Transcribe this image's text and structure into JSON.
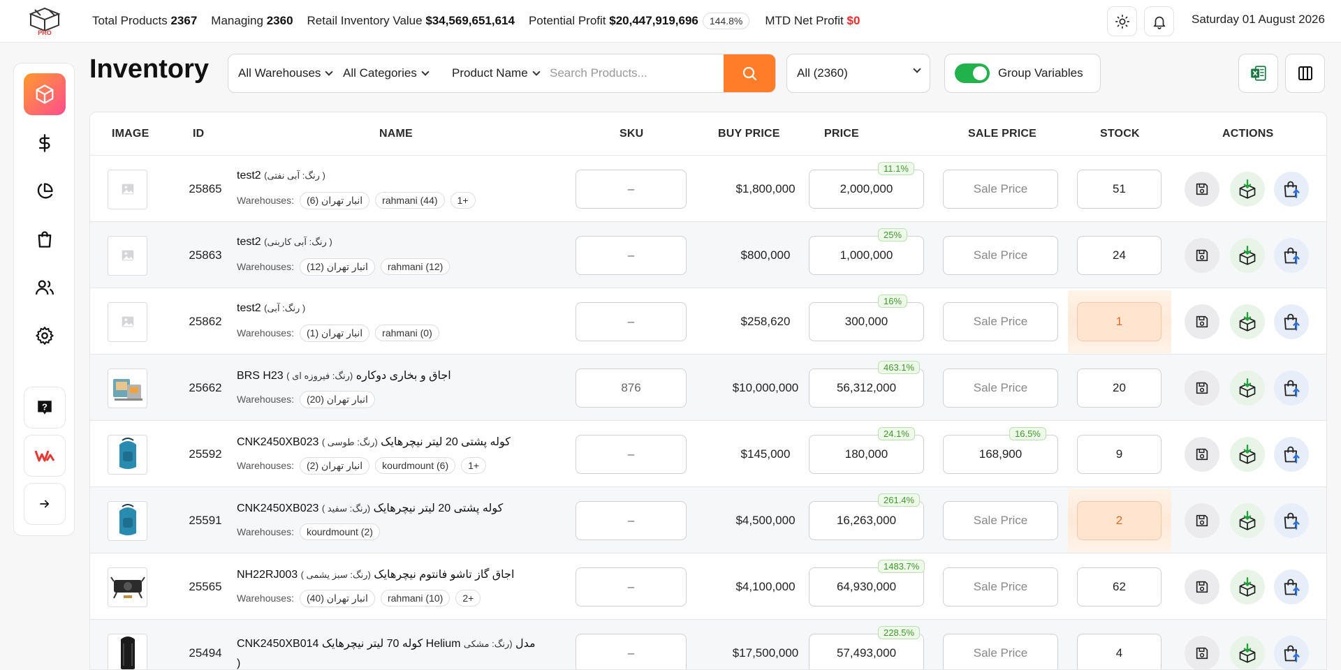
{
  "header": {
    "logo_text": "PRO",
    "total_products_label": "Total Products",
    "total_products": "2367",
    "managing_label": "Managing",
    "managing": "2360",
    "retail_value_label": "Retail Inventory Value",
    "retail_value": "$34,569,651,614",
    "potential_profit_label": "Potential Profit",
    "potential_profit": "$20,447,919,696",
    "potential_profit_pct": "144.8%",
    "mtd_label": "MTD Net Profit",
    "mtd_value": "$0",
    "date": "Saturday 01 August 2026"
  },
  "page": {
    "title": "Inventory"
  },
  "filters": {
    "warehouses": "All Warehouses",
    "categories": "All Categories",
    "field": "Product Name",
    "search_placeholder": "Search Products...",
    "all_select": "All (2360)",
    "group_label": "Group Variables",
    "group_on": true
  },
  "table": {
    "headers": [
      "IMAGE",
      "ID",
      "NAME",
      "SKU",
      "BUY PRICE",
      "PRICE",
      "SALE PRICE",
      "STOCK",
      "ACTIONS"
    ],
    "warehouses_label": "Warehouses:",
    "sale_placeholder": "Sale Price",
    "rows": [
      {
        "id": "25865",
        "name": "test2",
        "variant": "(رنگ: آبی نفتی )",
        "chips": [
          "انبار تهران (6)",
          "rahmani (44)",
          "1+"
        ],
        "sku": "–",
        "buy": "$1,800,000",
        "price": "2,000,000",
        "price_pct": "11.1%",
        "sale": "",
        "sale_pct": "",
        "stock": "51",
        "low": false,
        "img": "placeholder"
      },
      {
        "id": "25863",
        "name": "test2",
        "variant": "(رنگ: آبی کاربنی )",
        "chips": [
          "انبار تهران (12)",
          "rahmani (12)"
        ],
        "sku": "–",
        "buy": "$800,000",
        "price": "1,000,000",
        "price_pct": "25%",
        "sale": "",
        "sale_pct": "",
        "stock": "24",
        "low": false,
        "img": "placeholder"
      },
      {
        "id": "25862",
        "name": "test2",
        "variant": "(رنگ: آبی )",
        "chips": [
          "انبار تهران (1)",
          "rahmani (0)"
        ],
        "sku": "–",
        "buy": "$258,620",
        "price": "300,000",
        "price_pct": "16%",
        "sale": "",
        "sale_pct": "",
        "stock": "1",
        "low": true,
        "img": "placeholder"
      },
      {
        "id": "25662",
        "name": "BRS H23 اجاق و بخاری دوکاره",
        "variant": "(رنگ: فیروزه ای )",
        "chips": [
          "انبار تهران (20)"
        ],
        "sku": "876",
        "buy": "$10,000,000",
        "price": "56,312,000",
        "price_pct": "463.1%",
        "sale": "",
        "sale_pct": "",
        "stock": "20",
        "low": false,
        "img": "stove"
      },
      {
        "id": "25592",
        "name": "CNK2450XB023 کوله پشتی 20 لیتر نیچرهایک",
        "variant": "(رنگ: طوسی )",
        "chips": [
          "انبار تهران (2)",
          "kourdmount (6)",
          "1+"
        ],
        "sku": "–",
        "buy": "$145,000",
        "price": "180,000",
        "price_pct": "24.1%",
        "sale": "168,900",
        "sale_pct": "16.5%",
        "stock": "9",
        "low": false,
        "img": "backpack"
      },
      {
        "id": "25591",
        "name": "CNK2450XB023 کوله پشتی 20 لیتر نیچرهایک",
        "variant": "(رنگ: سفید )",
        "chips": [
          "kourdmount (2)"
        ],
        "sku": "–",
        "buy": "$4,500,000",
        "price": "16,263,000",
        "price_pct": "261.4%",
        "sale": "",
        "sale_pct": "",
        "stock": "2",
        "low": true,
        "img": "backpack"
      },
      {
        "id": "25565",
        "name": "NH22RJ003 اجاق گاز تاشو فانتوم نیچرهایک",
        "variant": "(رنگ: سبز یشمی )",
        "chips": [
          "انبار تهران (40)",
          "rahmani (10)",
          "2+"
        ],
        "sku": "–",
        "buy": "$4,100,000",
        "price": "64,930,000",
        "price_pct": "1483.7%",
        "sale": "",
        "sale_pct": "",
        "stock": "62",
        "low": false,
        "img": "burner"
      },
      {
        "id": "25494",
        "name": "CNK2450XB014 کوله 70 لیتر نیچرهایک Helium مدل",
        "variant": "(رنگ: مشکی",
        "name_line2": ")",
        "chips": [],
        "sku": "–",
        "buy": "$17,500,000",
        "price": "57,493,000",
        "price_pct": "228.5%",
        "sale": "",
        "sale_pct": "",
        "stock": "4",
        "low": false,
        "img": "blackpack"
      }
    ]
  },
  "colors": {
    "accent": "#ff7d29",
    "profit_red": "#ef2b2b",
    "toggle_green": "#22b24c",
    "pct_green": "#3e9a2a",
    "low_stock": "#e56a1d"
  },
  "icons": {
    "sidebar": [
      "box-icon",
      "dollar-icon",
      "pie-chart-icon",
      "shopping-bag-icon",
      "users-icon",
      "gear-icon",
      "help-icon",
      "brand-w-icon",
      "arrow-right-icon"
    ],
    "top": [
      "sun-icon",
      "bell-icon"
    ],
    "tools": [
      "excel-icon",
      "columns-icon"
    ],
    "actions": [
      "save-icon",
      "box-download-icon",
      "bag-upload-icon"
    ]
  }
}
